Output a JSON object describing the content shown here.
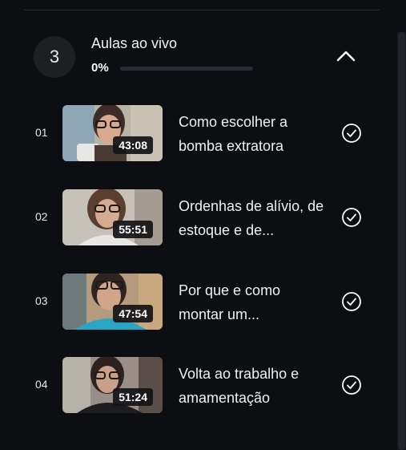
{
  "module": {
    "number": "3",
    "title": "Aulas ao vivo",
    "progress_text": "0%",
    "progress_fraction": 0,
    "collapse_icon": "chevron-up-icon"
  },
  "lessons": [
    {
      "number": "01",
      "duration": "43:08",
      "title": "Como escolher a bomba extratora",
      "status_icon": "check-circle-icon"
    },
    {
      "number": "02",
      "duration": "55:51",
      "title": "Ordenhas de alívio, de estoque e de...",
      "status_icon": "check-circle-icon"
    },
    {
      "number": "03",
      "duration": "47:54",
      "title": "Por que e como montar um...",
      "status_icon": "check-circle-icon"
    },
    {
      "number": "04",
      "duration": "51:24",
      "title": "Volta ao trabalho e amamentação",
      "status_icon": "check-circle-icon"
    }
  ],
  "colors": {
    "background": "#0d0e11",
    "text": "#f0f0f0",
    "badge_bg": "#1d1f23"
  }
}
